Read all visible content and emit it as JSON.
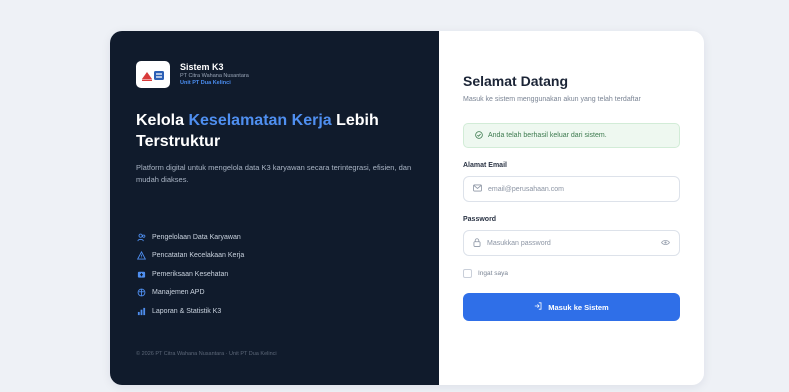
{
  "brand": {
    "title": "Sistem K3",
    "company": "PT Citra Wahana Nusantara",
    "unit": "Unit PT Dua Kelinci"
  },
  "hero": {
    "headline_part1": "Kelola ",
    "headline_highlight": "Keselamatan Kerja",
    "headline_part2": " Lebih Terstruktur",
    "description": "Platform digital untuk mengelola data K3 karyawan secara terintegrasi, efisien, dan mudah diakses."
  },
  "features": [
    {
      "label": "Pengelolaan Data Karyawan",
      "icon": "users-icon"
    },
    {
      "label": "Pencatatan Kecelakaan Kerja",
      "icon": "warning-icon"
    },
    {
      "label": "Pemeriksaan Kesehatan",
      "icon": "medical-icon"
    },
    {
      "label": "Manajemen APD",
      "icon": "shield-icon"
    },
    {
      "label": "Laporan & Statistik K3",
      "icon": "chart-icon"
    }
  ],
  "footer": "© 2026 PT Citra Wahana Nusantara · Unit PT Dua Kelinci",
  "login": {
    "title": "Selamat Datang",
    "subtitle": "Masuk ke sistem menggunakan akun yang telah terdaftar",
    "alert": "Anda telah berhasil keluar dari sistem.",
    "email_label": "Alamat Email",
    "email_placeholder": "email@perusahaan.com",
    "password_label": "Password",
    "password_placeholder": "Masukkan password",
    "remember_label": "Ingat saya",
    "submit_label": "Masuk ke Sistem"
  },
  "colors": {
    "accent": "#2f6fe8",
    "sidebar_bg": "#101b2c",
    "success_bg": "#eef8f0"
  }
}
